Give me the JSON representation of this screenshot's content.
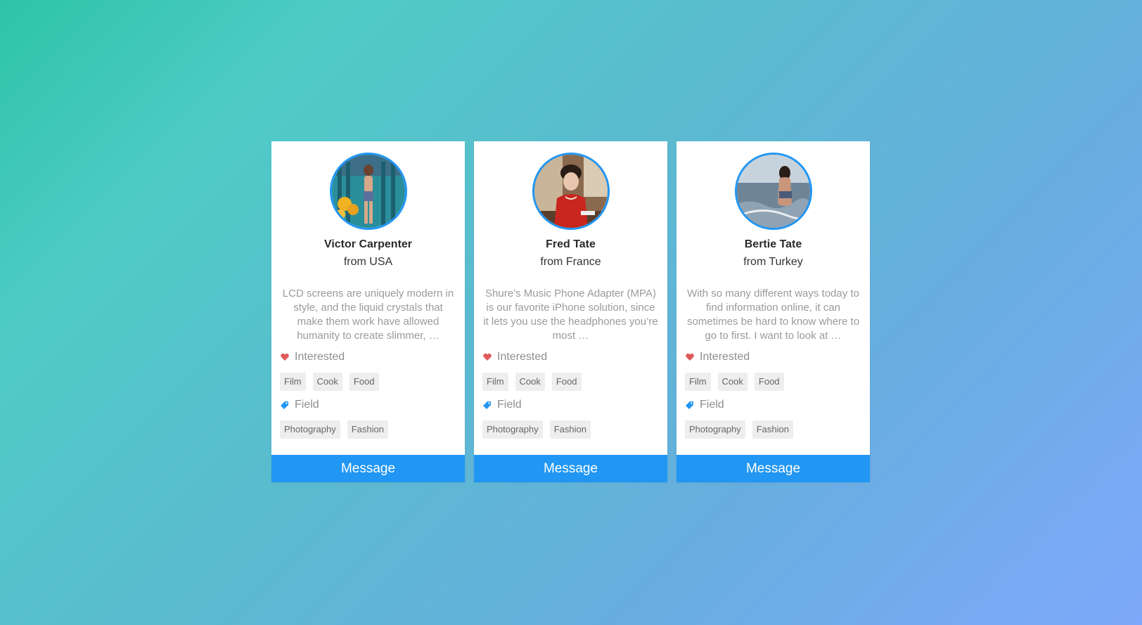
{
  "cards": [
    {
      "name": "Victor Carpenter",
      "origin": "from USA",
      "bio": "LCD screens are uniquely modern in style, and the liquid crystals that make them work have allowed humanity to create slimmer, …",
      "interested_label": "Interested",
      "interests": [
        "Film",
        "Cook",
        "Food"
      ],
      "field_label": "Field",
      "fields": [
        "Photography",
        "Fashion"
      ],
      "button_label": "Message"
    },
    {
      "name": "Fred Tate",
      "origin": "from France",
      "bio": "Shure’s Music Phone Adapter (MPA) is our favorite iPhone solution, since it lets you use the headphones you’re most …",
      "interested_label": "Interested",
      "interests": [
        "Film",
        "Cook",
        "Food"
      ],
      "field_label": "Field",
      "fields": [
        "Photography",
        "Fashion"
      ],
      "button_label": "Message"
    },
    {
      "name": "Bertie Tate",
      "origin": "from Turkey",
      "bio": "With so many different ways today to find information online, it can sometimes be hard to know where to go to first. I want to look at …",
      "interested_label": "Interested",
      "interests": [
        "Film",
        "Cook",
        "Food"
      ],
      "field_label": "Field",
      "fields": [
        "Photography",
        "Fashion"
      ],
      "button_label": "Message"
    }
  ],
  "colors": {
    "accent": "#2196f3",
    "heart": "#e05a5a",
    "tag_bg": "#eeeeee"
  },
  "icons": {
    "interested": "heart-icon",
    "field": "tag-icon"
  }
}
